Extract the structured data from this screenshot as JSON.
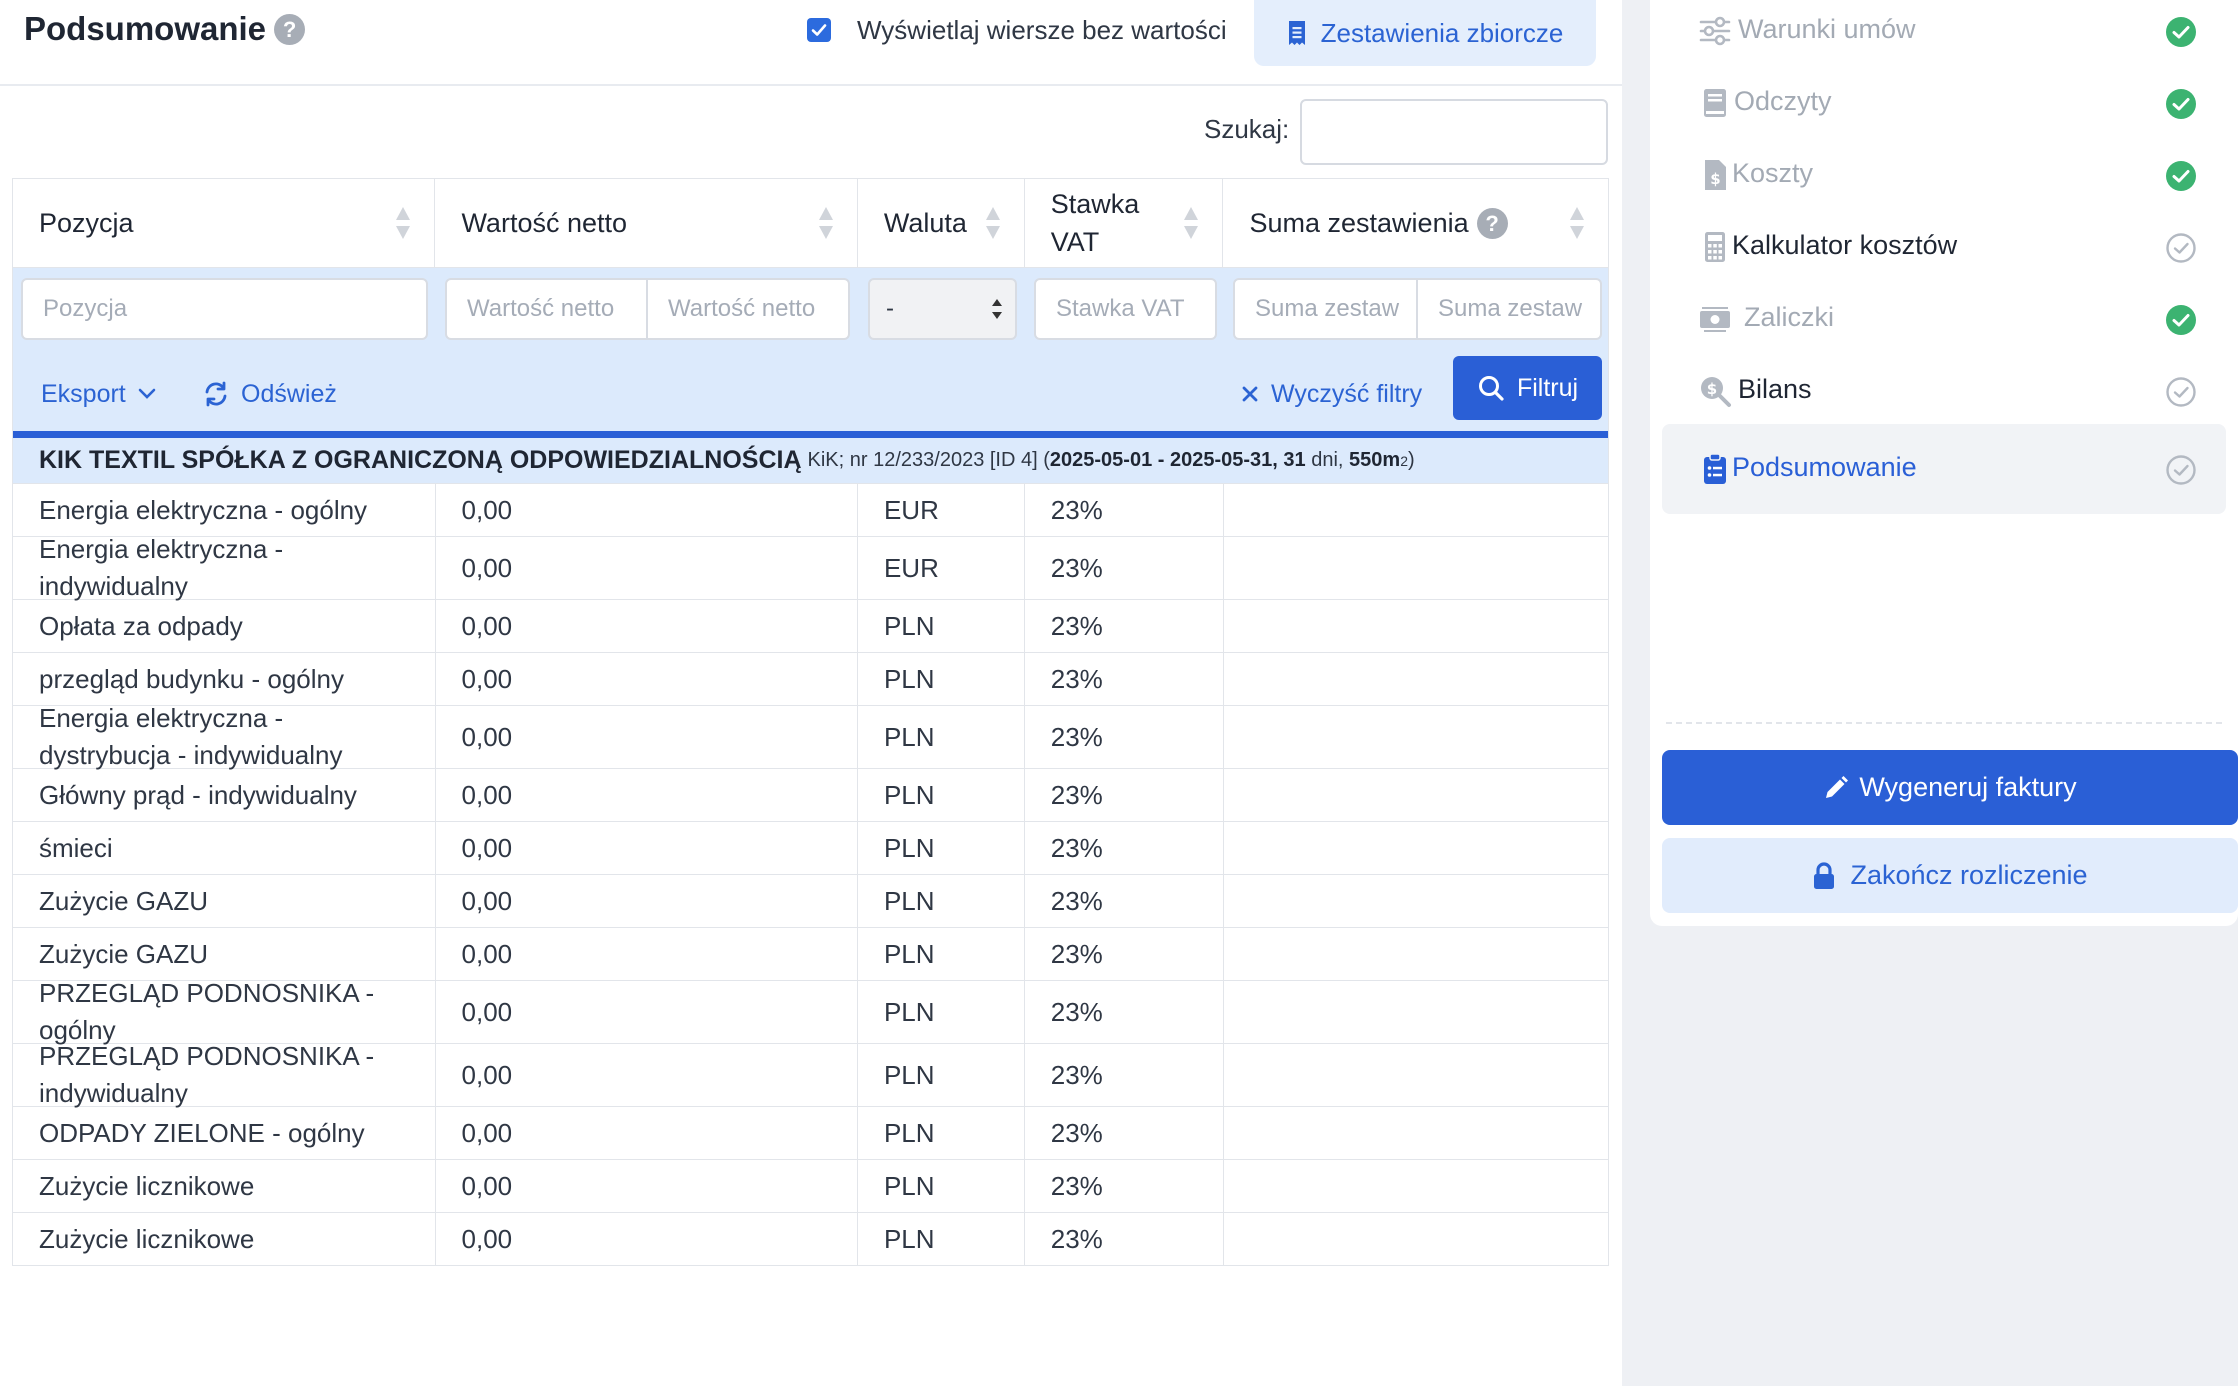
{
  "header": {
    "title": "Podsumowanie",
    "help": "?",
    "show_empty_label": "Wyświetlaj wiersze bez wartości",
    "show_empty_checked": true,
    "summary_button": "Zestawienia zbiorcze"
  },
  "search": {
    "label": "Szukaj:",
    "value": ""
  },
  "table": {
    "columns": [
      "Pozycja",
      "Wartość netto",
      "Waluta",
      "Stawka VAT",
      "Suma zestawienia"
    ],
    "help": "?",
    "filters": {
      "pozycja": "Pozycja",
      "netto_from": "Wartość netto",
      "netto_to": "Wartość netto",
      "waluta": "-",
      "vat": "Stawka VAT",
      "suma_from": "Suma zestaw",
      "suma_to": "Suma zestaw"
    },
    "toolbar": {
      "export": "Eksport",
      "refresh": "Odśwież",
      "clear": "Wyczyść filtry",
      "filter": "Filtruj"
    },
    "group": {
      "name": "KIK TEXTIL SPÓŁKA Z OGRANICZONĄ ODPOWIEDZIALNOŚCIĄ",
      "short": "KiK",
      "sep": ";",
      "contract": "nr 12/233/2023 [ID 4]",
      "open": "(",
      "period": "2025-05-01 - 2025-05-31, 31",
      "days": "dni,",
      "area": "550m",
      "sup": "2",
      "close": ")"
    },
    "rows": [
      {
        "pozycja": "Energia elektryczna - ogólny",
        "netto": "0,00",
        "waluta": "EUR",
        "vat": "23%",
        "suma": ""
      },
      {
        "pozycja": "Energia elektryczna - indywidualny",
        "netto": "0,00",
        "waluta": "EUR",
        "vat": "23%",
        "suma": ""
      },
      {
        "pozycja": "Opłata za odpady",
        "netto": "0,00",
        "waluta": "PLN",
        "vat": "23%",
        "suma": ""
      },
      {
        "pozycja": "przegląd budynku - ogólny",
        "netto": "0,00",
        "waluta": "PLN",
        "vat": "23%",
        "suma": ""
      },
      {
        "pozycja": "Energia elektryczna - dystrybucja - indywidualny",
        "netto": "0,00",
        "waluta": "PLN",
        "vat": "23%",
        "suma": ""
      },
      {
        "pozycja": "Główny prąd - indywidualny",
        "netto": "0,00",
        "waluta": "PLN",
        "vat": "23%",
        "suma": ""
      },
      {
        "pozycja": "śmieci",
        "netto": "0,00",
        "waluta": "PLN",
        "vat": "23%",
        "suma": ""
      },
      {
        "pozycja": "Zużycie GAZU",
        "netto": "0,00",
        "waluta": "PLN",
        "vat": "23%",
        "suma": ""
      },
      {
        "pozycja": "Zużycie GAZU",
        "netto": "0,00",
        "waluta": "PLN",
        "vat": "23%",
        "suma": ""
      },
      {
        "pozycja": "PRZEGLĄD PODNOSNIKA - ogólny",
        "netto": "0,00",
        "waluta": "PLN",
        "vat": "23%",
        "suma": ""
      },
      {
        "pozycja": "PRZEGLĄD PODNOSNIKA - indywidualny",
        "netto": "0,00",
        "waluta": "PLN",
        "vat": "23%",
        "suma": ""
      },
      {
        "pozycja": "ODPADY ZIELONE - ogólny",
        "netto": "0,00",
        "waluta": "PLN",
        "vat": "23%",
        "suma": ""
      },
      {
        "pozycja": "Zużycie licznikowe",
        "netto": "0,00",
        "waluta": "PLN",
        "vat": "23%",
        "suma": ""
      },
      {
        "pozycja": "Zużycie licznikowe",
        "netto": "0,00",
        "waluta": "PLN",
        "vat": "23%",
        "suma": ""
      }
    ]
  },
  "sidebar": {
    "steps": [
      {
        "label": "Warunki umów",
        "icon": "sliders-icon",
        "status": "done"
      },
      {
        "label": "Odczyty",
        "icon": "book-icon",
        "status": "done"
      },
      {
        "label": "Koszty",
        "icon": "invoice-dollar-icon",
        "status": "done"
      },
      {
        "label": "Kalkulator kosztów",
        "icon": "calculator-icon",
        "status": "pending"
      },
      {
        "label": "Zaliczki",
        "icon": "money-bills-icon",
        "status": "done"
      },
      {
        "label": "Bilans",
        "icon": "search-dollar-icon",
        "status": "pending"
      },
      {
        "label": "Podsumowanie",
        "icon": "clipboard-list-icon",
        "status": "active"
      }
    ],
    "generate_button": "Wygeneruj faktury",
    "finish_button": "Zakończ rozliczenie"
  },
  "colors": {
    "primary": "#2a5fd6",
    "primary_light": "#dceafc",
    "success": "#3cb371",
    "muted": "#a3aab4"
  }
}
